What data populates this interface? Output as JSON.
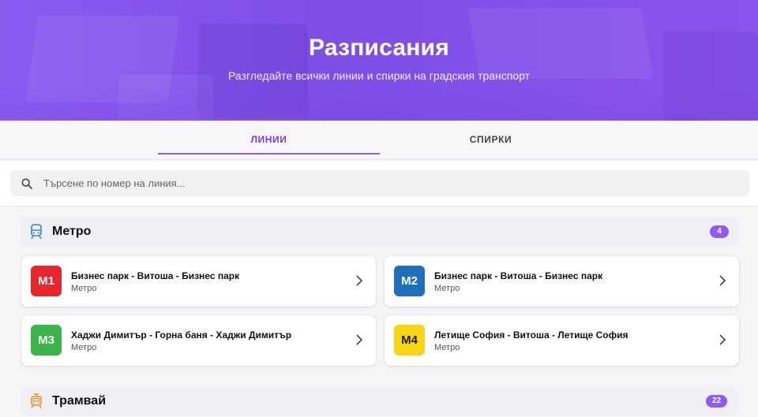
{
  "hero": {
    "title": "Разписания",
    "subtitle": "Разгледайте всички линии и спирки на градския транспорт"
  },
  "tabs": [
    {
      "label": "ЛИНИИ",
      "active": true
    },
    {
      "label": "СПИРКИ",
      "active": false
    }
  ],
  "search": {
    "placeholder": "Търсене по номер на линия...",
    "value": ""
  },
  "sections": [
    {
      "title": "Метро",
      "icon": "metro-icon",
      "count": "4",
      "lines": [
        {
          "code": "M1",
          "route": "Бизнес парк - Витоша - Бизнес парк",
          "type": "Метро",
          "color": "#e8262c"
        },
        {
          "code": "M2",
          "route": "Бизнес парк - Витоша - Бизнес парк",
          "type": "Метро",
          "color": "#1e6fbd"
        },
        {
          "code": "M3",
          "route": "Хаджи Димитър - Горна баня - Хаджи Димитър",
          "type": "Метро",
          "color": "#3bb54a"
        },
        {
          "code": "M4",
          "route": "Летище София - Витоша - Летище София",
          "type": "Метро",
          "color": "#f7d414"
        }
      ]
    },
    {
      "title": "Трамвай",
      "icon": "tram-icon",
      "count": "22"
    }
  ],
  "colors": {
    "accent": "#8b5cf6",
    "hero_gradient_start": "#8b5cf0",
    "hero_gradient_end": "#8a55ec"
  }
}
